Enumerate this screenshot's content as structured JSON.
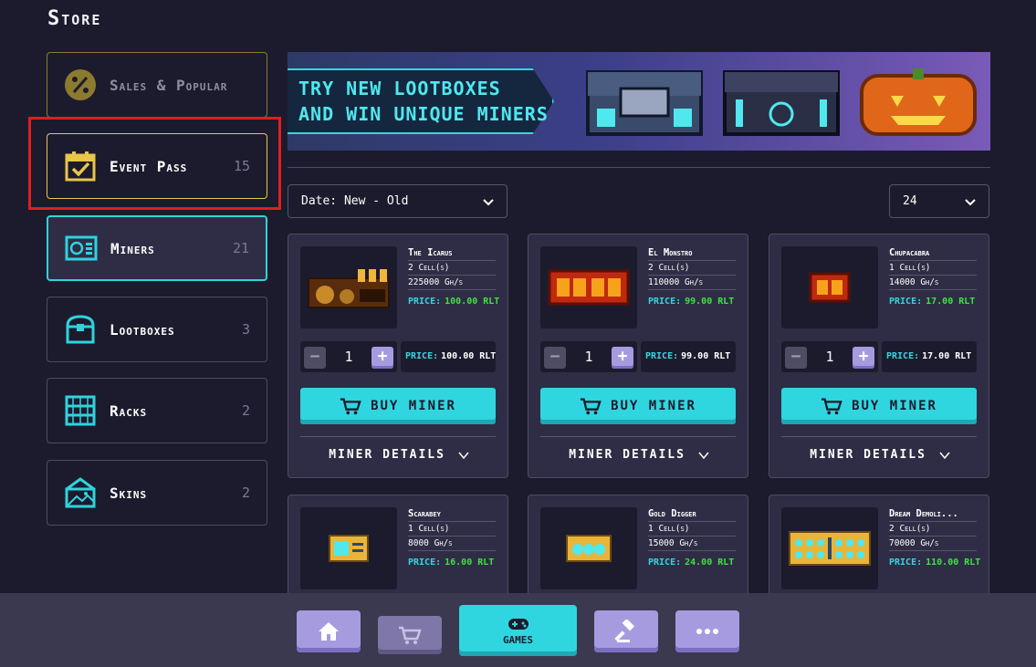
{
  "page": {
    "title": "Store"
  },
  "sidebar": {
    "items": [
      {
        "label": "Sales & Popular",
        "count": ""
      },
      {
        "label": "Event Pass",
        "count": "15"
      },
      {
        "label": "Miners",
        "count": "21"
      },
      {
        "label": "Lootboxes",
        "count": "3"
      },
      {
        "label": "Racks",
        "count": "2"
      },
      {
        "label": "Skins",
        "count": "2"
      }
    ]
  },
  "banner": {
    "line1": "TRY NEW LOOTBOXES",
    "line2": "AND WIN UNIQUE MINERS"
  },
  "filters": {
    "sort": "Date: New - Old",
    "per_page": "24"
  },
  "product": {
    "price_label": "PRICE:",
    "buy_label": "BUY MINER",
    "details_label": "MINER DETAILS"
  },
  "cards": [
    {
      "name": "The Icarus",
      "cells": "2 Cell(s)",
      "power": "225000 Gh/s",
      "price": "100.00 RLT",
      "qty": "1"
    },
    {
      "name": "El Monstro",
      "cells": "2 Cell(s)",
      "power": "110000 Gh/s",
      "price": "99.00 RLT",
      "qty": "1"
    },
    {
      "name": "Chupacabra",
      "cells": "1 Cell(s)",
      "power": "14000 Gh/s",
      "price": "17.00 RLT",
      "qty": "1"
    },
    {
      "name": "Scarabey",
      "cells": "1 Cell(s)",
      "power": "8000 Gh/s",
      "price": "16.00 RLT"
    },
    {
      "name": "Gold Digger",
      "cells": "1 Cell(s)",
      "power": "15000 Gh/s",
      "price": "24.00 RLT"
    },
    {
      "name": "Dream Demoli...",
      "cells": "2 Cell(s)",
      "power": "70000 Gh/s",
      "price": "110.00 RLT"
    }
  ],
  "bottom_nav": {
    "games_label": "GAMES"
  },
  "colors": {
    "accent": "#2fd6e0",
    "highlight": "#e01e1e",
    "gold": "#e8c64a",
    "price_value": "#3fe23f"
  }
}
